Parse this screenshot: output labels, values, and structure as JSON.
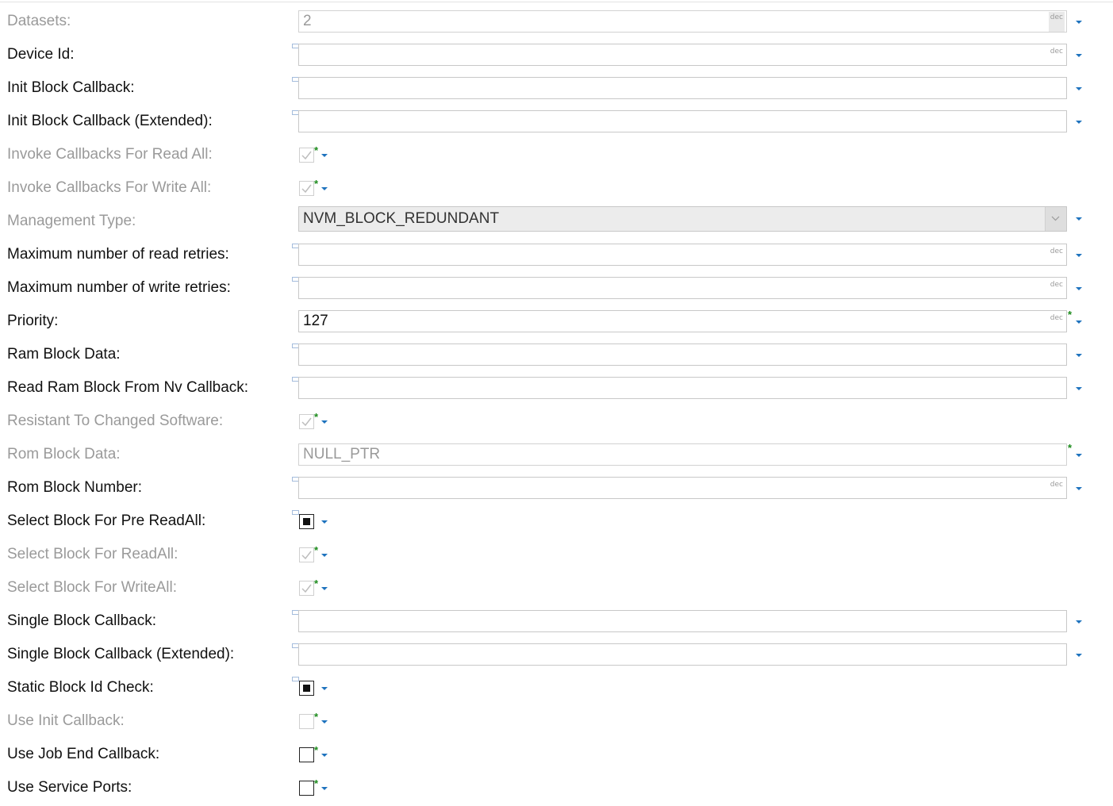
{
  "rows": [
    {
      "label": "Datasets:",
      "value": "2",
      "unit": "dec"
    },
    {
      "label": "Device Id:",
      "value": "",
      "unit": "dec"
    },
    {
      "label": "Init Block Callback:",
      "value": ""
    },
    {
      "label": "Init Block Callback (Extended):",
      "value": ""
    },
    {
      "label": "Invoke Callbacks For Read All:",
      "checked": true
    },
    {
      "label": "Invoke Callbacks For Write All:",
      "checked": true
    },
    {
      "label": "Management Type:",
      "value": "NVM_BLOCK_REDUNDANT"
    },
    {
      "label": "Maximum number of read retries:",
      "value": "",
      "unit": "dec"
    },
    {
      "label": "Maximum number of write retries:",
      "value": "",
      "unit": "dec"
    },
    {
      "label": "Priority:",
      "value": "127",
      "unit": "dec"
    },
    {
      "label": "Ram Block Data:",
      "value": ""
    },
    {
      "label": "Read Ram Block From Nv Callback:",
      "value": ""
    },
    {
      "label": "Resistant To Changed Software:",
      "checked": true
    },
    {
      "label": "Rom Block Data:",
      "value": "NULL_PTR"
    },
    {
      "label": "Rom Block Number:",
      "value": "",
      "unit": "dec"
    },
    {
      "label": "Select Block For Pre ReadAll:",
      "checked": true
    },
    {
      "label": "Select Block For ReadAll:",
      "checked": true
    },
    {
      "label": "Select Block For WriteAll:",
      "checked": true
    },
    {
      "label": "Single Block Callback:",
      "value": ""
    },
    {
      "label": "Single Block Callback (Extended):",
      "value": ""
    },
    {
      "label": "Static Block Id Check:",
      "checked": true
    },
    {
      "label": "Use Init Callback:",
      "checked": false
    },
    {
      "label": "Use Job End Callback:",
      "checked": false
    },
    {
      "label": "Use Service Ports:",
      "checked": false
    }
  ],
  "colors": {
    "accent_dropdown": "#1e73be",
    "default_marker": "#1a8a1a",
    "disabled_text": "#9a9a9a"
  }
}
